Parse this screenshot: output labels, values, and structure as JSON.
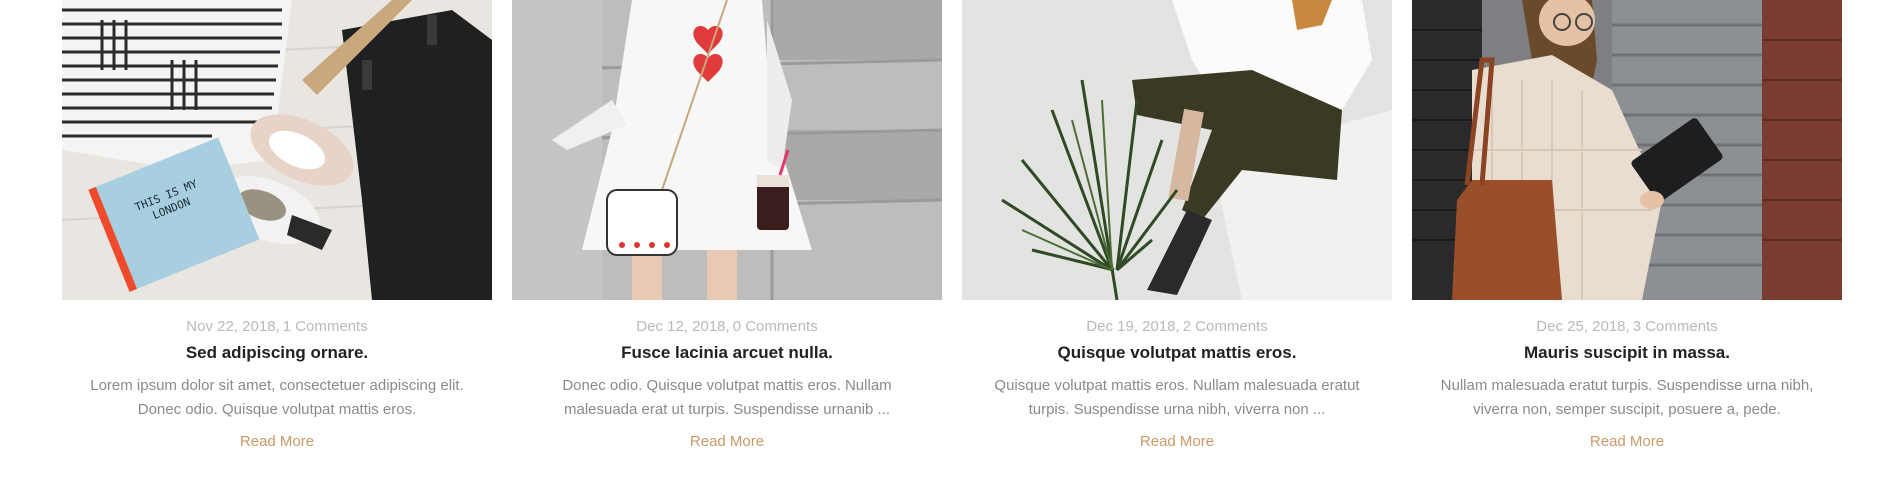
{
  "colors": {
    "accent": "#c99a67",
    "meta": "#b9b9b9",
    "title": "#222222",
    "excerpt": "#8a8a8a"
  },
  "posts": [
    {
      "image": "flatlay-striped-shirt-sneakers-notebook",
      "notebook_text": "THIS IS MY LONDON",
      "date": "Nov 22, 2018,",
      "comments": "1 Comments",
      "title": "Sed adipiscing ornare.",
      "excerpt": "Lorem ipsum dolor sit amet, consectetuer adipiscing elit. Donec odio. Quisque volutpat mattis eros.",
      "read_more": "Read More"
    },
    {
      "image": "woman-white-dress-heart-bag",
      "date": "Dec 12, 2018,",
      "comments": "0 Comments",
      "title": "Fusce lacinia arcuet nulla.",
      "excerpt": "Donec odio. Quisque volutpat mattis eros. Nullam malesuada erat ut turpis. Suspendisse urnanib ...",
      "read_more": "Read More"
    },
    {
      "image": "woman-olive-pants-palm-leaf",
      "date": "Dec 19, 2018,",
      "comments": "2 Comments",
      "title": "Quisque volutpat mattis eros.",
      "excerpt": "Quisque volutpat mattis eros. Nullam malesuada eratut turpis. Suspendisse urna nibh, viverra non ...",
      "read_more": "Read More"
    },
    {
      "image": "woman-tablet-brick-wall",
      "date": "Dec 25, 2018,",
      "comments": "3 Comments",
      "title": "Mauris suscipit in massa.",
      "excerpt": "Nullam malesuada eratut turpis. Suspendisse urna nibh, viverra non, semper suscipit, posuere a, pede.",
      "read_more": "Read More"
    }
  ]
}
